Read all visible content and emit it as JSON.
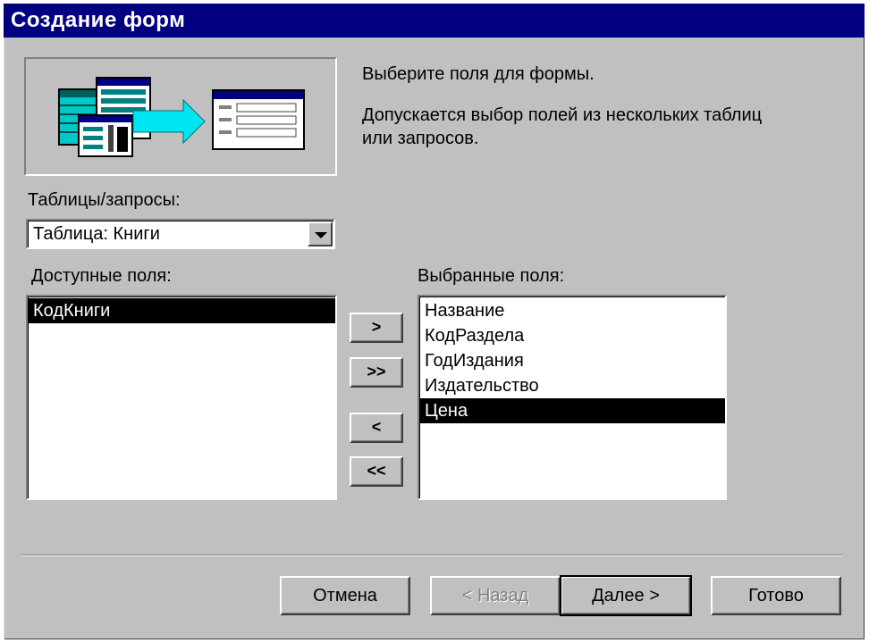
{
  "window": {
    "title": "Создание форм"
  },
  "description": {
    "line1": "Выберите поля для формы.",
    "line2a": "Допускается выбор полей из нескольких таблиц",
    "line2b": "или запросов."
  },
  "tables_queries": {
    "label": "Таблицы/запросы:",
    "selected_value": "Таблица: Книги"
  },
  "available_fields": {
    "label": "Доступные поля:",
    "items": [
      "КодКниги"
    ],
    "selected_index": 0
  },
  "selected_fields": {
    "label": "Выбранные поля:",
    "items": [
      "Название",
      "КодРаздела",
      "ГодИздания",
      "Издательство",
      "Цена"
    ],
    "selected_index": 4
  },
  "move_buttons": {
    "add_one": ">",
    "add_all": ">>",
    "remove_one": "<",
    "remove_all": "<<"
  },
  "footer_buttons": {
    "cancel": "Отмена",
    "back": "< Назад",
    "next": "Далее >",
    "finish": "Готово"
  },
  "colors": {
    "title_bar": "#000080",
    "dialog_bg": "#c0c0c0",
    "selection_bg": "#000000",
    "illustration_arrow": "#00e5f0",
    "illustration_table": "#008080"
  }
}
